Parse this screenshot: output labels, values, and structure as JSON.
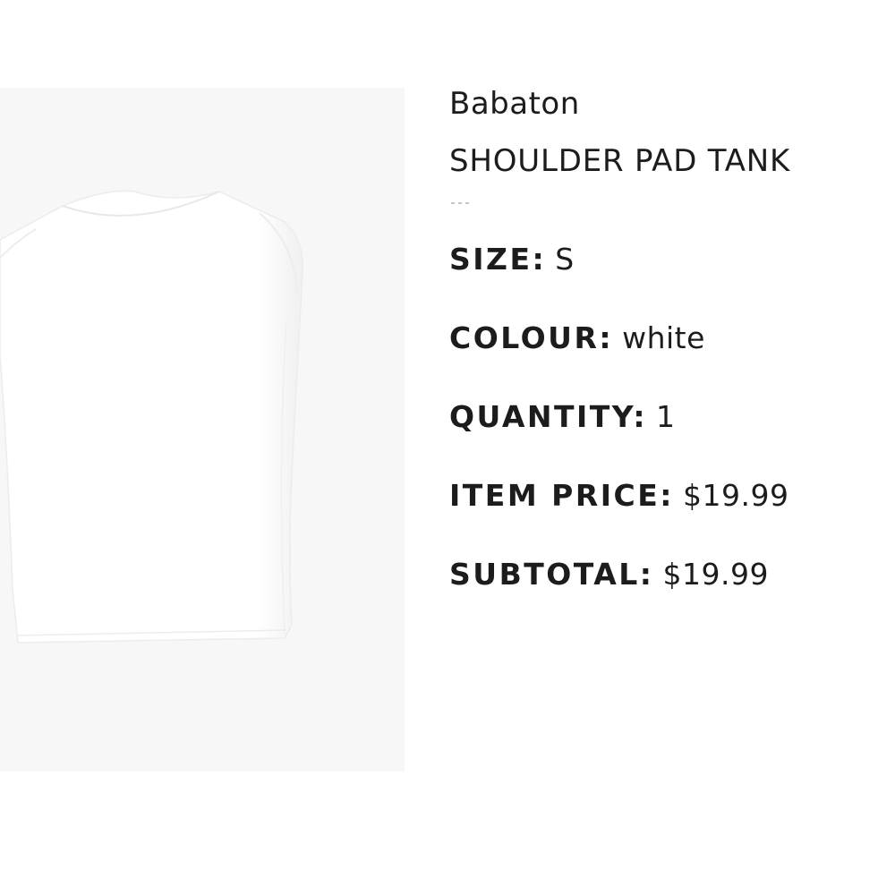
{
  "product": {
    "brand": "Babaton",
    "name": "SHOULDER PAD TANK",
    "image_icon": "white-shoulder-pad-tank-image",
    "attributes": [
      {
        "label": "SIZE:",
        "value": "S"
      },
      {
        "label": "COLOUR:",
        "value": "white"
      },
      {
        "label": "QUANTITY:",
        "value": "1"
      },
      {
        "label": "ITEM PRICE:",
        "value": "$19.99"
      },
      {
        "label": "SUBTOTAL:",
        "value": "$19.99"
      }
    ]
  },
  "colors": {
    "page_background": "#ffffff",
    "image_background": "#f7f7f7",
    "text": "#1c1c1c"
  }
}
